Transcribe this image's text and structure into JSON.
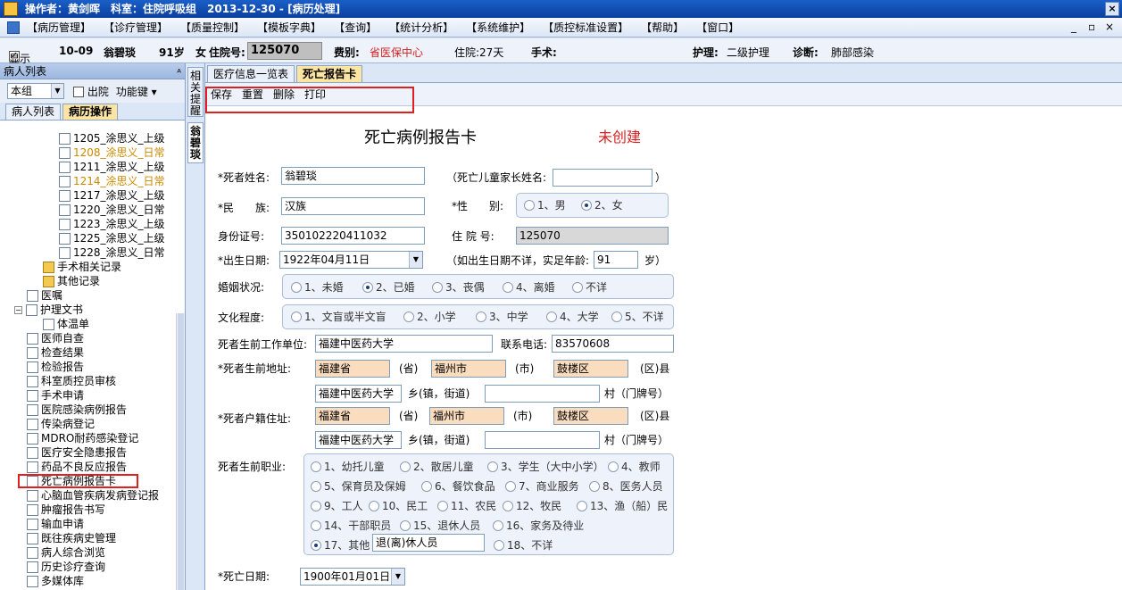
{
  "window": {
    "title": "操作者：黄剑晖　科室：住院呼吸组　2013-12-30 - [病历处理]"
  },
  "menu": [
    "【病历管理】",
    "【诊疗管理】",
    "【质量控制】",
    "【模板字典】",
    "【查询】",
    "【统计分析】",
    "【系统维护】",
    "【质控标准设置】",
    "【帮助】",
    "【窗口】"
  ],
  "patient": {
    "show_label": "显示",
    "bed": "10-09",
    "name": "翁碧琰",
    "age": "91岁",
    "sex": "女",
    "inpatient_label": "住院号:",
    "inpatient_no": "125070",
    "fee_label": "费别:",
    "fee_value": "省医保中心",
    "stay": "住院:27天",
    "surgery_label": "手术:",
    "nursing_label": "护理:",
    "nursing_value": "二级护理",
    "diag_label": "诊断:",
    "diag_value": "肺部感染"
  },
  "leftpane": {
    "title": "病人列表",
    "pin": "ᴬ",
    "group_select": "本组",
    "discharge_label": "出院",
    "func_label": "功能键",
    "tabs": [
      "病人列表",
      "病历操作"
    ],
    "tree": [
      {
        "label": "1205_涂思义_上级",
        "hl": false
      },
      {
        "label": "1208_涂思义_日常",
        "hl": true
      },
      {
        "label": "1211_涂思义_上级",
        "hl": false
      },
      {
        "label": "1214_涂思义_日常",
        "hl": true
      },
      {
        "label": "1217_涂思义_上级",
        "hl": false
      },
      {
        "label": "1220_涂思义_日常",
        "hl": false
      },
      {
        "label": "1223_涂思义_上级",
        "hl": false
      },
      {
        "label": "1225_涂思义_上级",
        "hl": false
      },
      {
        "label": "1228_涂思义_日常",
        "hl": false
      },
      {
        "label": "手术相关记录",
        "hl": false
      },
      {
        "label": "其他记录",
        "hl": false
      },
      {
        "label": "医嘱",
        "hl": false
      },
      {
        "label": "护理文书",
        "hl": false
      },
      {
        "label": "体温单",
        "hl": false
      },
      {
        "label": "医师自查",
        "hl": false
      },
      {
        "label": "检查结果",
        "hl": false
      },
      {
        "label": "检验报告",
        "hl": false
      },
      {
        "label": "科室质控员审核",
        "hl": false
      },
      {
        "label": "手术申请",
        "hl": false
      },
      {
        "label": "医院感染病例报告",
        "hl": false
      },
      {
        "label": "传染病登记",
        "hl": false
      },
      {
        "label": "MDRO耐药感染登记",
        "hl": false
      },
      {
        "label": "医疗安全隐患报告",
        "hl": false
      },
      {
        "label": "药品不良反应报告",
        "hl": false
      },
      {
        "label": "死亡病例报告卡",
        "hl": false
      },
      {
        "label": "心脑血管疾病发病登记报",
        "hl": false
      },
      {
        "label": "肿瘤报告书写",
        "hl": false
      },
      {
        "label": "输血申请",
        "hl": false
      },
      {
        "label": "既往疾病史管理",
        "hl": false
      },
      {
        "label": "病人综合浏览",
        "hl": false
      },
      {
        "label": "历史诊疗查询",
        "hl": false
      },
      {
        "label": "多媒体库",
        "hl": false
      }
    ]
  },
  "sidetabs": [
    "相关提醒",
    "翁碧琰"
  ],
  "main": {
    "tabs": [
      "医疗信息一览表",
      "死亡报告卡"
    ],
    "toolbar": [
      "保存",
      "重置",
      "删除",
      "打印"
    ],
    "form": {
      "title": "死亡病例报告卡",
      "status": "未创建",
      "name_label": "*死者姓名:",
      "name_value": "翁碧琰",
      "child_parent_label": "（死亡儿童家长姓名:",
      "child_parent_close": "）",
      "ethnic_label": "*民　　族:",
      "ethnic_value": "汉族",
      "sex_label": "*性　　别:",
      "sex_opts": [
        "1、男",
        "2、女"
      ],
      "id_label": "身份证号:",
      "id_value": "350102220411032",
      "inpatient_label": "住 院 号:",
      "inpatient_value": "125070",
      "birth_label": "*出生日期:",
      "birth_value": "1922年04月11日",
      "age_hint": "（如出生日期不详，实足年龄:",
      "age_value": "91",
      "age_unit": "岁）",
      "marital_label": "婚姻状况:",
      "marital_opts": [
        "1、未婚",
        "2、已婚",
        "3、丧偶",
        "4、离婚",
        "不详"
      ],
      "edu_label": "文化程度:",
      "edu_opts": [
        "1、文盲或半文盲",
        "2、小学",
        "3、中学",
        "4、大学",
        "5、不详"
      ],
      "work_label": "死者生前工作单位:",
      "work_value": "福建中医药大学",
      "phone_label": "联系电话:",
      "phone_value": "83570608",
      "addr_label": "*死者生前地址:",
      "reg_label": "*死者户籍住址:",
      "province": "福建省",
      "prov_unit": "(省)",
      "city": "福州市",
      "city_unit": "(市)",
      "district": "鼓楼区",
      "dist_unit": "(区)县",
      "town": "福建中医药大学",
      "town_unit": "乡(镇，街道)",
      "village_unit": "村（门牌号）",
      "job_label": "死者生前职业:",
      "job_opts": [
        "1、幼托儿童",
        "2、散居儿童",
        "3、学生（大中小学）",
        "4、教师",
        "5、保育员及保姆",
        "6、餐饮食品",
        "7、商业服务",
        "8、医务人员",
        "9、工人",
        "10、民工",
        "11、农民",
        "12、牧民",
        "13、渔（船）民",
        "14、干部职员",
        "15、退休人员",
        "16、家务及待业",
        "17、其他",
        "18、不详"
      ],
      "job_other_value": "退(离)休人员",
      "death_label": "*死亡日期:",
      "death_value": "1900年01月01日"
    }
  }
}
